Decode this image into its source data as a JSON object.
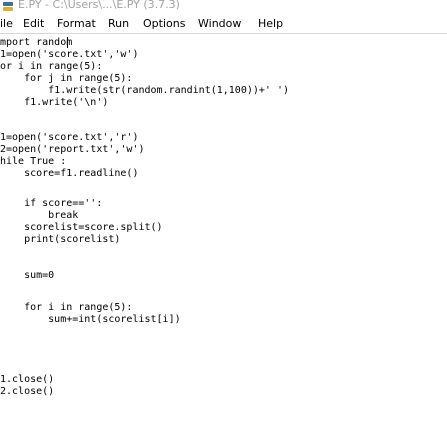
{
  "window": {
    "title": "E.PY - C:\\Users\\...\\E.PY (3.7.3)"
  },
  "menubar": {
    "items": [
      "ile",
      "Edit",
      "Format",
      "Run",
      "Options",
      "Window",
      "Help"
    ]
  },
  "editor": {
    "lines": [
      "mport random",
      "1=open('score.txt','w')",
      "or i in range(5):",
      "    for j in range(5):",
      "        f1.write(str(random.randint(1,100))+' ')",
      "    f1.write('\\n')",
      "",
      "1=open('score.txt','r')",
      "2=open('report.txt','w')",
      "hile True :",
      "    score=f1.readline()",
      "",
      "    if score=='':",
      "        break",
      "    scorelist=score.split()",
      "    print(scorelist)",
      "",
      "",
      "    sum=0",
      "",
      "    for i in range(5):",
      "        sum+=int(scorelist[i])",
      "",
      "",
      "",
      "1.close()",
      "2.close()"
    ]
  }
}
